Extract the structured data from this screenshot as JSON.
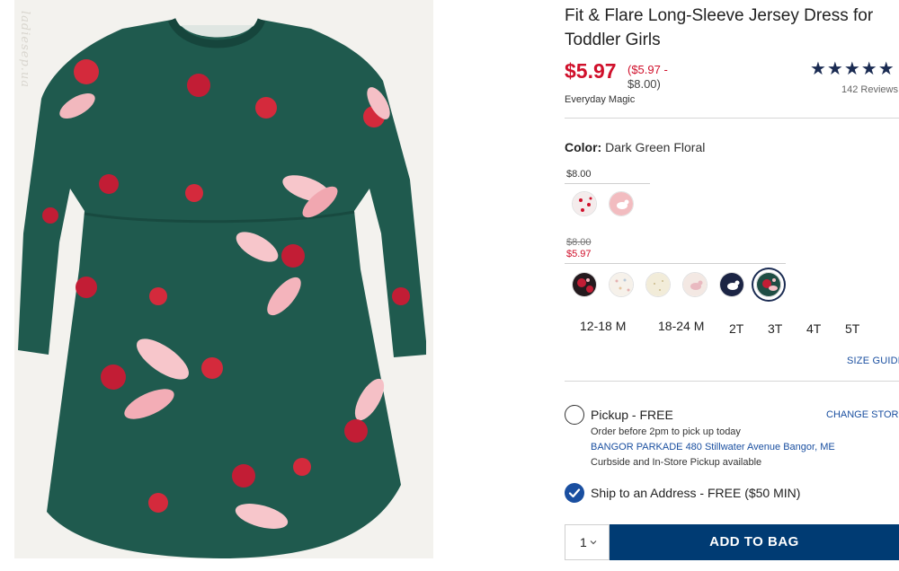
{
  "watermark": "ladiesep.ua",
  "product": {
    "title": "Fit & Flare Long-Sleeve Jersey Dress for Toddler Girls",
    "price_now": "$5.97",
    "price_range_low": "($5.97 -",
    "price_range_high": "$8.00)",
    "badge": "Everyday Magic",
    "stars": "★★★★★",
    "reviews": "142 Reviews"
  },
  "color": {
    "label": "Color:",
    "value": "Dark Green Floral"
  },
  "price_tiers": [
    {
      "price": "$8.00",
      "swatch_count": 2
    },
    {
      "old_price": "$8.00",
      "sale_price": "$5.97",
      "swatch_count": 6
    }
  ],
  "swatches": [
    {
      "name": "white-red-hearts",
      "color": "#f4ecec"
    },
    {
      "name": "pink-unicorn",
      "color": "#f2bcc0"
    },
    {
      "name": "black-red-floral",
      "color": "#241a1e"
    },
    {
      "name": "white-confetti-dots",
      "color": "#f6f1ea"
    },
    {
      "name": "cream-sparkle",
      "color": "#f2ecd9"
    },
    {
      "name": "ivory-unicorn",
      "color": "#f3e8e3"
    },
    {
      "name": "navy-unicorn",
      "color": "#1b2444"
    },
    {
      "name": "dark-green-floral",
      "color": "#1f4d44",
      "selected": true
    }
  ],
  "sizes": [
    "12-18 M",
    "18-24 M",
    "2T",
    "3T",
    "4T",
    "5T"
  ],
  "size_guide": "SIZE GUIDE",
  "fulfillment": {
    "pickup_label": "Pickup - FREE",
    "change_store": "CHANGE STORE",
    "pickup_note": "Order before 2pm to pick up today",
    "store_name": "BANGOR PARKADE",
    "store_address": "480 Stillwater Avenue",
    "store_city": "Bangor, ME",
    "store_note": "Curbside and In-Store Pickup available",
    "ship_label": "Ship to an Address - FREE ($50 MIN)",
    "ship_selected": true
  },
  "cart": {
    "qty": "1",
    "add_label": "ADD TO BAG"
  },
  "colors": {
    "price_red": "#d0102b",
    "navy": "#003b73",
    "link_blue": "#1a4fa0",
    "dress_green": "#1f5a4e"
  }
}
